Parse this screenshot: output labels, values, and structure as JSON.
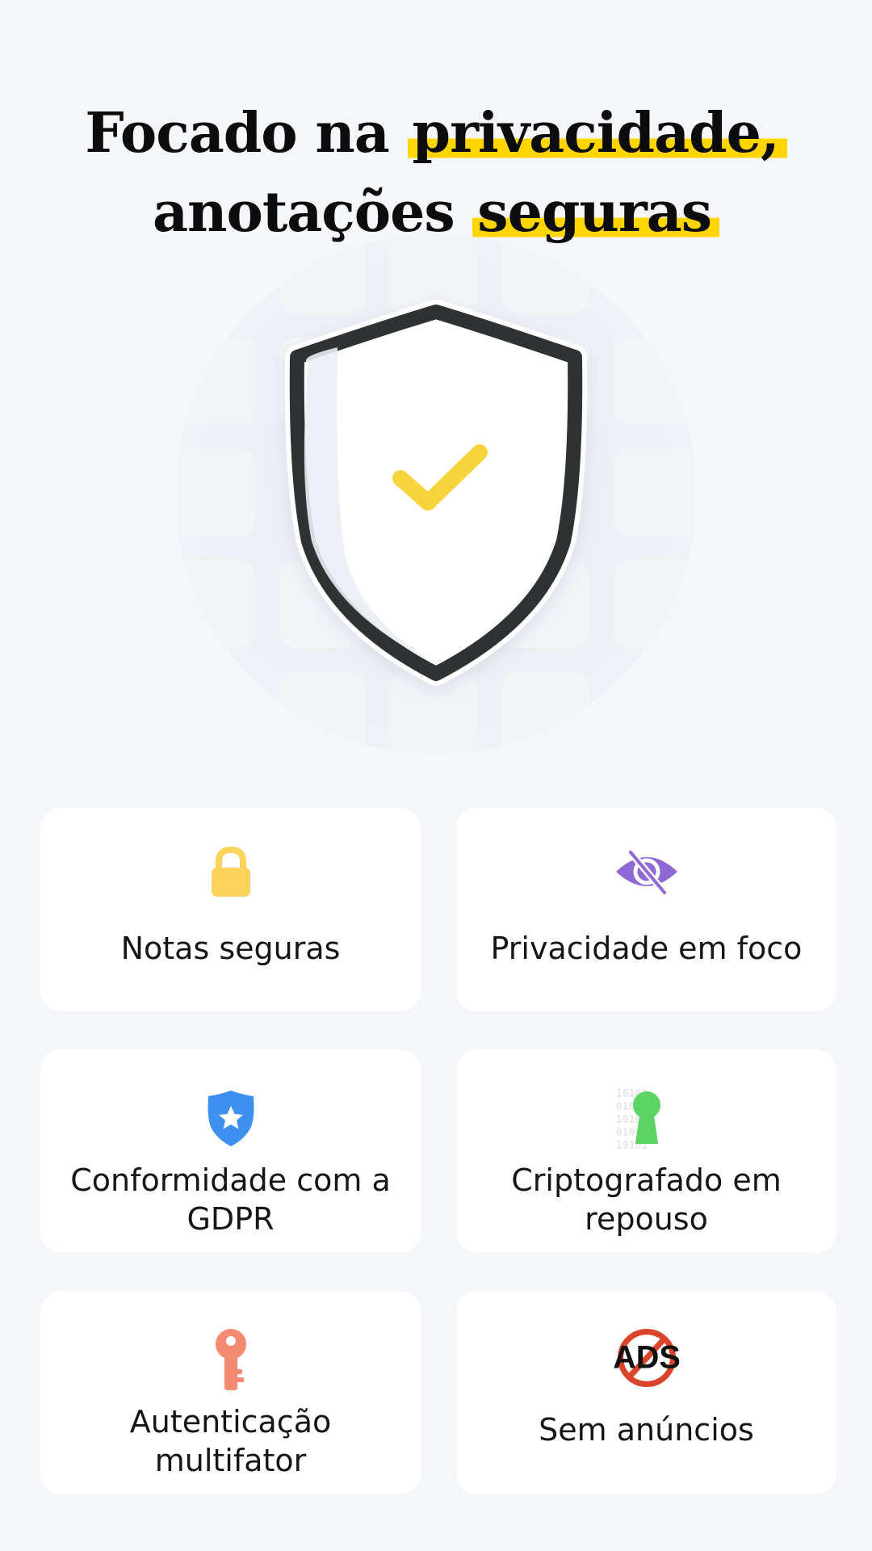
{
  "headline": {
    "line1_plain": "Focado na ",
    "line1_highlight": "privacidade,",
    "line2_plain": "anotações ",
    "line2_highlight": "seguras"
  },
  "colors": {
    "background": "#f4f6f9",
    "highlight": "#ffd500",
    "shield_outline": "#2e3033",
    "check": "#f7d43b",
    "lock": "#fcd35b",
    "eye": "#9068d6",
    "gdpr_shield": "#3d8ff0",
    "keyhole": "#5bd365",
    "key": "#f58a72",
    "no_ads": "#d9442a"
  },
  "illustration": {
    "name": "security-shield-check"
  },
  "features": [
    {
      "label": "Notas seguras",
      "icon": "lock-icon"
    },
    {
      "label": "Privacidade em foco",
      "icon": "eye-slash-icon"
    },
    {
      "label": "Conformidade com a GDPR",
      "icon": "gdpr-shield-star-icon"
    },
    {
      "label": "Criptografado em repouso",
      "icon": "encrypted-keyhole-icon"
    },
    {
      "label": "Autenticação multifator",
      "icon": "key-icon"
    },
    {
      "label": "Sem anúncios",
      "icon": "no-ads-icon",
      "icon_text": "ADS"
    }
  ]
}
